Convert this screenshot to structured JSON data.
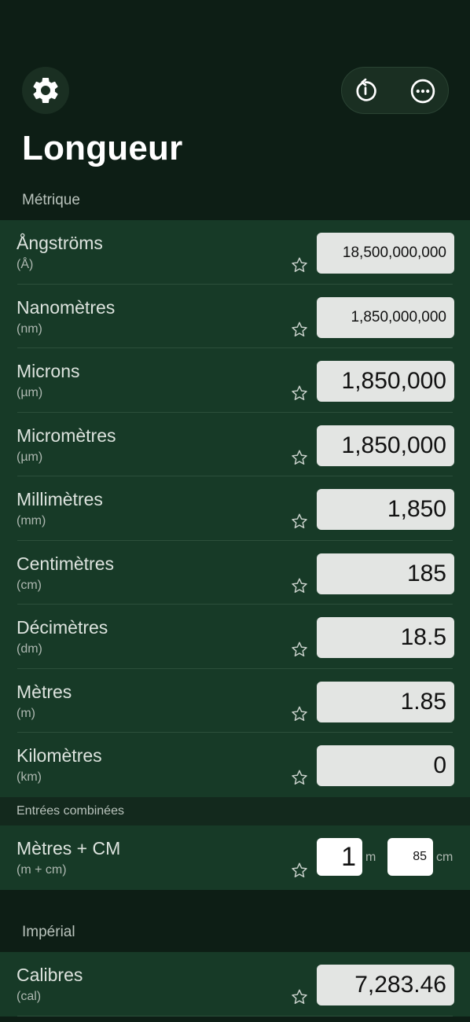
{
  "header": {
    "title": "Longueur"
  },
  "icons": {
    "settings": "gear-icon",
    "reset": "rotate-ccw-icon",
    "more": "ellipsis-circle-icon",
    "favorite": "star-outline-icon"
  },
  "metric": {
    "label": "Métrique",
    "units": [
      {
        "name": "Ångströms",
        "symbol": "(Å)",
        "value": "18,500,000,000"
      },
      {
        "name": "Nanomètres",
        "symbol": "(nm)",
        "value": "1,850,000,000"
      },
      {
        "name": "Microns",
        "symbol": "(µm)",
        "value": "1,850,000"
      },
      {
        "name": "Micromètres",
        "symbol": "(µm)",
        "value": "1,850,000"
      },
      {
        "name": "Millimètres",
        "symbol": "(mm)",
        "value": "1,850"
      },
      {
        "name": "Centimètres",
        "symbol": "(cm)",
        "value": "185"
      },
      {
        "name": "Décimètres",
        "symbol": "(dm)",
        "value": "18.5"
      },
      {
        "name": "Mètres",
        "symbol": "(m)",
        "value": "1.85"
      },
      {
        "name": "Kilomètres",
        "symbol": "(km)",
        "value": "0"
      }
    ]
  },
  "combined": {
    "label": "Entrées combinées",
    "name": "Mètres + CM",
    "symbol": "(m + cm)",
    "meters_value": "1",
    "meters_unit": "m",
    "cm_value": "85",
    "cm_unit": "cm"
  },
  "imperial": {
    "label": "Impérial",
    "units": [
      {
        "name": "Calibres",
        "symbol": "(cal)",
        "value": "7,283.46"
      }
    ]
  },
  "colors": {
    "background": "#0d1e15",
    "row_background": "#173a27",
    "field_background": "#e3e5e3"
  }
}
